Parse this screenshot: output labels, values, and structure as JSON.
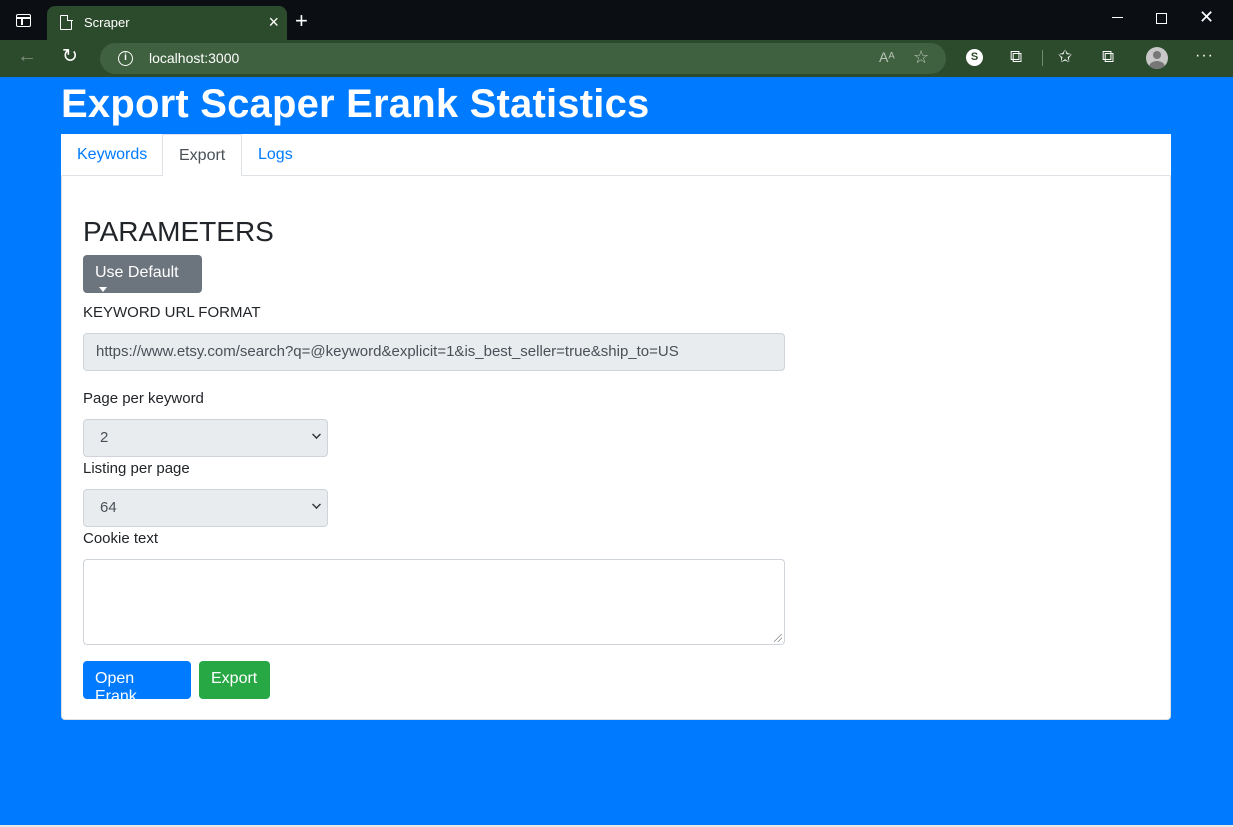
{
  "browser": {
    "tab_title": "Scraper",
    "tab_close": "×",
    "new_tab": "+",
    "url": "localhost:3000",
    "read_aloud": "A⁾",
    "minimize": "",
    "close": "✕"
  },
  "page": {
    "title": "Export Scaper Erank Statistics",
    "tabs": [
      {
        "label": "Keywords",
        "active": false
      },
      {
        "label": "Export",
        "active": true
      },
      {
        "label": "Logs",
        "active": false
      }
    ],
    "section_title": "PARAMETERS",
    "use_default_label": "Use Default",
    "keyword_url_label": "KEYWORD URL FORMAT",
    "keyword_url_value": "https://www.etsy.com/search?q=@keyword&explicit=1&is_best_seller=true&ship_to=US",
    "page_per_keyword_label": "Page per keyword",
    "page_per_keyword_value": "2",
    "listing_per_page_label": "Listing per page",
    "listing_per_page_value": "64",
    "cookie_text_label": "Cookie text",
    "cookie_text_value": "",
    "open_erank_label": "Open Erank",
    "export_label": "Export"
  },
  "colors": {
    "page_background": "#007bff",
    "primary": "#007bff",
    "success": "#28a745",
    "secondary": "#6c757d",
    "browser_frame": "#2c4a2c"
  }
}
